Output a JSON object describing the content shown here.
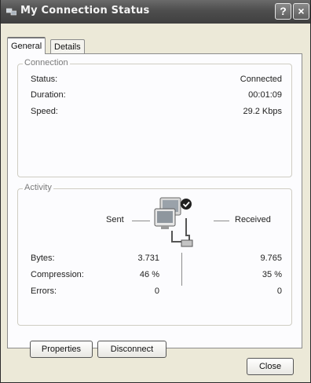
{
  "window": {
    "title": "My Connection Status"
  },
  "titlebar": {
    "help_label": "?",
    "close_label": "×"
  },
  "tabs": [
    {
      "label": "General"
    },
    {
      "label": "Details"
    }
  ],
  "connection": {
    "legend": "Connection",
    "rows": [
      {
        "label": "Status:",
        "value": "Connected"
      },
      {
        "label": "Duration:",
        "value": "00:01:09"
      },
      {
        "label": "Speed:",
        "value": "29.2 Kbps"
      }
    ]
  },
  "activity": {
    "legend": "Activity",
    "sent_label": "Sent",
    "received_label": "Received",
    "rows": [
      {
        "label": "Bytes:",
        "sent": "3.731",
        "received": "9.765"
      },
      {
        "label": "Compression:",
        "sent": "46 %",
        "received": "35 %"
      },
      {
        "label": "Errors:",
        "sent": "0",
        "received": "0"
      }
    ]
  },
  "buttons": {
    "properties": "Properties",
    "disconnect": "Disconnect",
    "close": "Close"
  },
  "icons": [
    "network-connection-icon",
    "help-icon",
    "close-icon",
    "network-activity-icon"
  ]
}
